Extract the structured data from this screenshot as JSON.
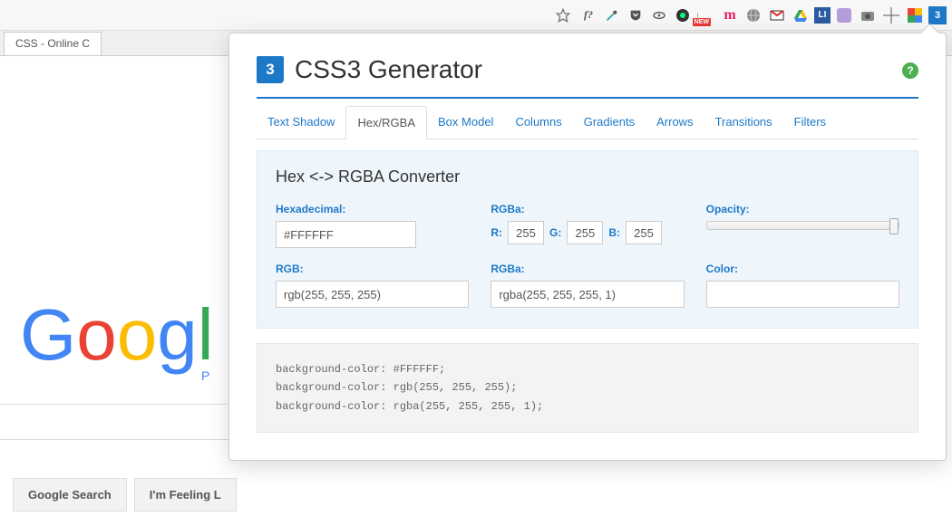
{
  "browser": {
    "tab_title": "CSS - Online C",
    "extensions": {
      "new_badge": "NEW",
      "font_label": "f?",
      "pinterest_label": "m"
    }
  },
  "google": {
    "letters": [
      "G",
      "o",
      "o",
      "g",
      "l"
    ],
    "sub": "P",
    "search_btn": "Google Search",
    "lucky_btn": "I'm Feeling L"
  },
  "popup": {
    "title": "CSS3 Generator",
    "help": "?",
    "tabs": [
      "Text Shadow",
      "Hex/RGBA",
      "Box Model",
      "Columns",
      "Gradients",
      "Arrows",
      "Transitions",
      "Filters"
    ],
    "active_tab_index": 1,
    "panel": {
      "title": "Hex <-> RGBA Converter",
      "hex_label": "Hexadecimal:",
      "hex_value": "#FFFFFF",
      "rgba_chan_label": "RGBa:",
      "r_label": "R:",
      "g_label": "G:",
      "b_label": "B:",
      "r_val": "255",
      "g_val": "255",
      "b_val": "255",
      "opacity_label": "Opacity:",
      "rgb_label": "RGB:",
      "rgb_value": "rgb(255, 255, 255)",
      "rgba_label": "RGBa:",
      "rgba_value": "rgba(255, 255, 255, 1)",
      "color_label": "Color:",
      "swatch_color": "#FFFFFF"
    },
    "code": "background-color: #FFFFFF;\nbackground-color: rgb(255, 255, 255);\nbackground-color: rgba(255, 255, 255, 1);"
  }
}
